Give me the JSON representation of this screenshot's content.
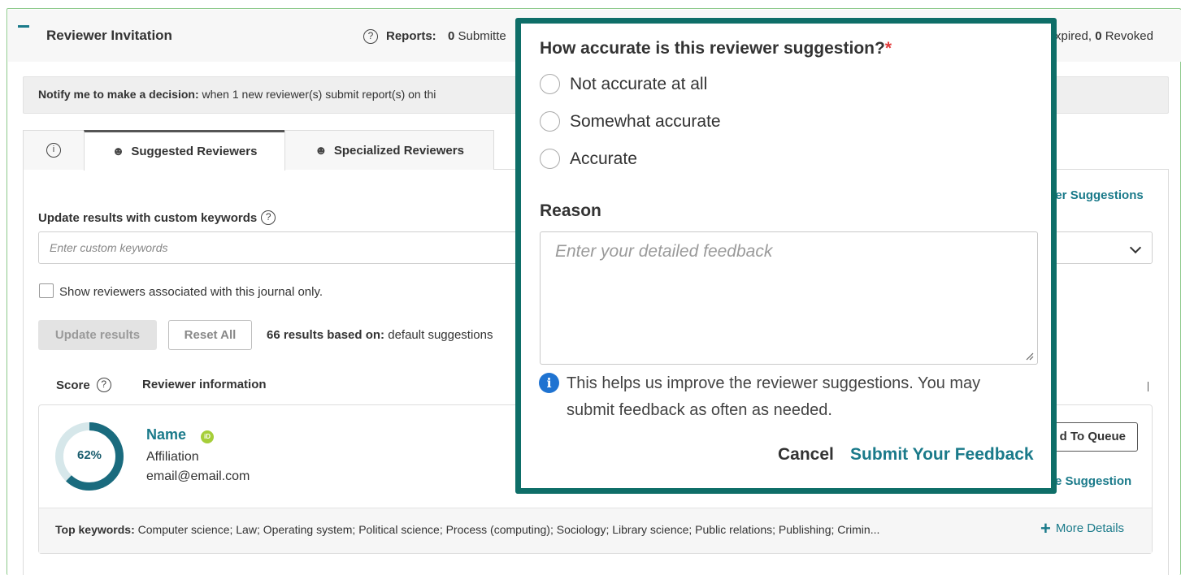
{
  "header": {
    "title": "Reviewer Invitation",
    "reports_label": "Reports:",
    "submitted_count": "0",
    "submitted_text": "Submitte",
    "expired_text": "xpired,",
    "revoked_count": "0",
    "revoked_text": "Revoked"
  },
  "notify": {
    "label": "Notify me to make a decision:",
    "text": "when 1 new reviewer(s) submit report(s) on thi"
  },
  "tabs": [
    {
      "label": ""
    },
    {
      "label": "Suggested Reviewers"
    },
    {
      "label": "Specialized Reviewers"
    }
  ],
  "view_suggestions_link": "ver Suggestions",
  "search": {
    "label": "Update results with custom keywords",
    "placeholder": "Enter custom keywords"
  },
  "journal_filter_label": "Show reviewers associated with this journal only.",
  "buttons": {
    "update": "Update results",
    "reset": "Reset All"
  },
  "results": {
    "count_label": "66 results based on:",
    "basis": "default suggestions"
  },
  "columns": {
    "score": "Score",
    "reviewer_info": "Reviewer information"
  },
  "reviewer": {
    "score_percent": 62,
    "score_label": "62%",
    "name": "Name",
    "affiliation": "Affiliation",
    "email": "email@email.com",
    "queue_button": "d To Queue",
    "rate_link": "e Suggestion",
    "keywords_label": "Top keywords:",
    "keywords": "Computer science; Law; Operating system; Political science; Process (computing); Sociology; Library science; Public relations; Publishing; Crimin...",
    "more_details": "More Details"
  },
  "feedback": {
    "question": "How accurate is this reviewer suggestion?",
    "required_mark": "*",
    "options": [
      "Not accurate at all",
      "Somewhat accurate",
      "Accurate"
    ],
    "reason_label": "Reason",
    "reason_placeholder": "Enter your detailed feedback",
    "help_text": "This helps us improve the reviewer suggestions. You may submit feedback as often as needed.",
    "cancel": "Cancel",
    "submit": "Submit Your Feedback"
  },
  "colors": {
    "accent": "#1a7a8a",
    "modal_border": "#0e6e68",
    "required": "#e23b3b",
    "info": "#1f73d1",
    "panel_border": "#8cc98a"
  }
}
